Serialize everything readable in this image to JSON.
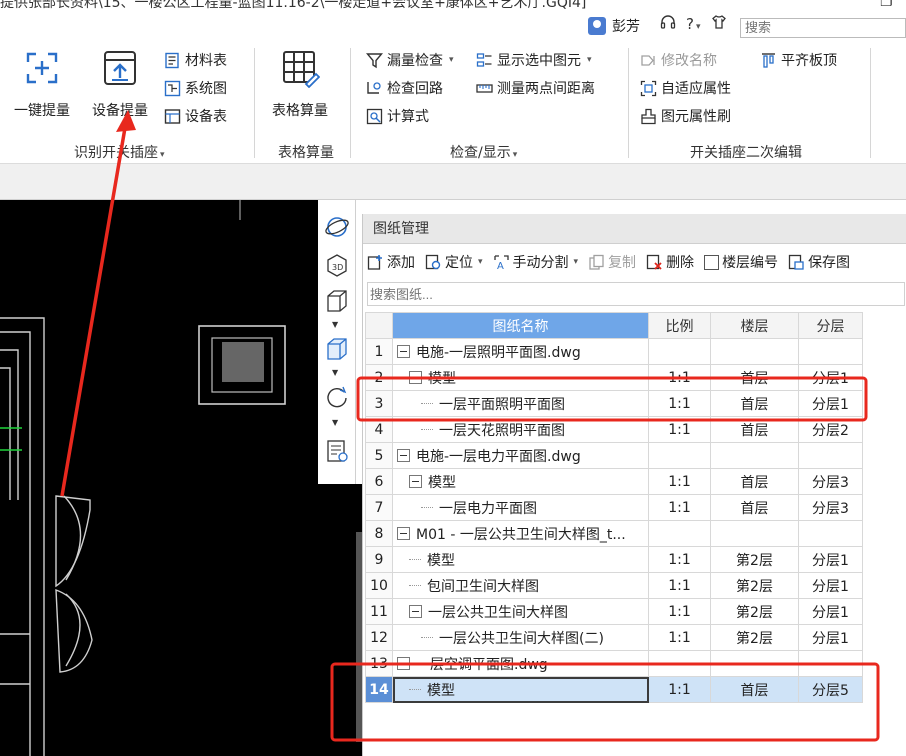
{
  "window": {
    "title": "提供张部长资料\\15、一楼公区工程量-蓝图11.16-2\\一楼走道+会议室+康体区+艺术厅.GQI4]",
    "user_name": "彭芳",
    "help_label": "?",
    "search_placeholder": "搜索"
  },
  "ribbon": {
    "group1": {
      "label": "识别开关插座",
      "one_click": "一键提量",
      "device_calc": "设备提量",
      "material_table": "材料表",
      "system_diagram": "系统图",
      "device_table": "设备表"
    },
    "group2": {
      "label": "表格算量",
      "table_calc": "表格算量"
    },
    "group3": {
      "label": "检查/显示",
      "leak_check": "漏量检查",
      "show_selected": "显示选中图元",
      "check_loop": "检查回路",
      "measure_distance": "测量两点间距离",
      "formula": "计算式"
    },
    "group4": {
      "label": "开关插座二次编辑",
      "rename": "修改名称",
      "align_top": "平齐板顶",
      "adaptive_attr": "自适应属性",
      "attr_brush": "图元属性刷"
    }
  },
  "panel": {
    "title": "图纸管理",
    "toolbar": {
      "add": "添加",
      "locate": "定位",
      "manual_split": "手动分割",
      "copy": "复制",
      "delete": "删除",
      "floor_number": "楼层编号",
      "save": "保存图"
    },
    "search_placeholder": "搜索图纸...",
    "columns": [
      "图纸名称",
      "比例",
      "楼层",
      "分层"
    ],
    "rows": [
      {
        "no": "1",
        "name": "电施-一层照明平面图.dwg",
        "scale": "",
        "floor": "",
        "layer": ""
      },
      {
        "no": "2",
        "name": "模型",
        "scale": "1:1",
        "floor": "首层",
        "layer": "分层1"
      },
      {
        "no": "3",
        "name": "一层平面照明平面图",
        "scale": "1:1",
        "floor": "首层",
        "layer": "分层1"
      },
      {
        "no": "4",
        "name": "一层天花照明平面图",
        "scale": "1:1",
        "floor": "首层",
        "layer": "分层2"
      },
      {
        "no": "5",
        "name": "电施-一层电力平面图.dwg",
        "scale": "",
        "floor": "",
        "layer": ""
      },
      {
        "no": "6",
        "name": "模型",
        "scale": "1:1",
        "floor": "首层",
        "layer": "分层3"
      },
      {
        "no": "7",
        "name": "一层电力平面图",
        "scale": "1:1",
        "floor": "首层",
        "layer": "分层3"
      },
      {
        "no": "8",
        "name": "M01 - 一层公共卫生间大样图_t...",
        "scale": "",
        "floor": "",
        "layer": ""
      },
      {
        "no": "9",
        "name": "模型",
        "scale": "1:1",
        "floor": "第2层",
        "layer": "分层1"
      },
      {
        "no": "10",
        "name": "包间卫生间大样图",
        "scale": "1:1",
        "floor": "第2层",
        "layer": "分层1"
      },
      {
        "no": "11",
        "name": "一层公共卫生间大样图",
        "scale": "1:1",
        "floor": "第2层",
        "layer": "分层1"
      },
      {
        "no": "12",
        "name": "一层公共卫生间大样图(二)",
        "scale": "1:1",
        "floor": "第2层",
        "layer": "分层1"
      },
      {
        "no": "13",
        "name": "一层空调平面图.dwg",
        "scale": "",
        "floor": "",
        "layer": ""
      },
      {
        "no": "14",
        "name": "模型",
        "scale": "1:1",
        "floor": "首层",
        "layer": "分层5"
      }
    ]
  },
  "colors": {
    "annotation_red": "#e8281e",
    "header_blue": "#6fa6e8",
    "selected_row": "#cfe3f7"
  }
}
